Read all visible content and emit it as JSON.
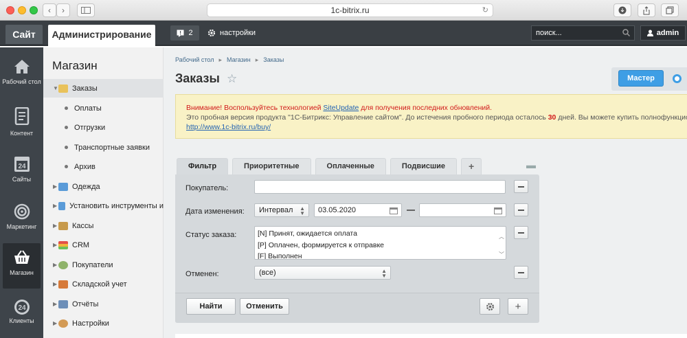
{
  "browser": {
    "url": "1c-bitrix.ru"
  },
  "topbar": {
    "site_tab": "Сайт",
    "admin_tab": "Администрирование",
    "notif_count": "2",
    "settings_label": "настройки",
    "search_placeholder": "поиск...",
    "user_name": "admin"
  },
  "leftnav": {
    "items": [
      {
        "label": "Рабочий стол",
        "icon": "home-icon"
      },
      {
        "label": "Контент",
        "icon": "document-icon"
      },
      {
        "label": "Сайты",
        "icon": "calendar-24-icon"
      },
      {
        "label": "Маркетинг",
        "icon": "target-icon"
      },
      {
        "label": "Магазин",
        "icon": "basket-icon",
        "active": true
      },
      {
        "label": "Клиенты",
        "icon": "clients-24-icon"
      }
    ]
  },
  "sidemenu": {
    "title": "Магазин",
    "items": [
      {
        "label": "Заказы",
        "type": "folder",
        "selected": true
      },
      {
        "label": "Оплаты",
        "type": "sub"
      },
      {
        "label": "Отгрузки",
        "type": "sub"
      },
      {
        "label": "Транспортные заявки",
        "type": "sub"
      },
      {
        "label": "Архив",
        "type": "sub"
      },
      {
        "label": "Одежда",
        "type": "folder"
      },
      {
        "label": "Установить инструменты и",
        "type": "folder"
      },
      {
        "label": "Кассы",
        "type": "folder"
      },
      {
        "label": "CRM",
        "type": "folder"
      },
      {
        "label": "Покупатели",
        "type": "folder"
      },
      {
        "label": "Складской учет",
        "type": "folder"
      },
      {
        "label": "Отчёты",
        "type": "folder"
      },
      {
        "label": "Настройки",
        "type": "folder"
      }
    ]
  },
  "breadcrumb": [
    "Рабочий стол",
    "Магазин",
    "Заказы"
  ],
  "page": {
    "title": "Заказы",
    "master_button": "Мастер"
  },
  "warning": {
    "line1_prefix": "Внимание! Воспользуйтесь технологией ",
    "line1_link": "SiteUpdate",
    "line1_suffix": " для получения последних обновлений.",
    "line2_prefix": "Это пробная версия продукта \"1С-Битрикс: Управление сайтом\". До истечения пробного периода осталось ",
    "line2_days": "30",
    "line2_suffix": " дней. Вы можете купить полнофункциональ",
    "line3_link": "http://www.1c-bitrix.ru/buy/"
  },
  "filter": {
    "tabs": [
      "Фильтр",
      "Приоритетные",
      "Оплаченные",
      "Подвисшие"
    ],
    "buyer_label": "Покупатель:",
    "buyer_value": "",
    "date_label": "Дата изменения:",
    "date_mode": "Интервал",
    "date_from": "03.05.2020",
    "date_to": "",
    "status_label": "Статус заказа:",
    "status_options": [
      "[N] Принят, ожидается оплата",
      "[P] Оплачен, формируется к отправке",
      "[F] Выполнен"
    ],
    "cancelled_label": "Отменен:",
    "cancelled_value": "(все)",
    "find_button": "Найти",
    "cancel_button": "Отменить"
  },
  "colors": {
    "topbar": "#3a3f44",
    "leftnav": "#3e444a",
    "accent": "#3e9ee5",
    "warning_bg": "#f9f2c6",
    "warning_text": "#d11a1a"
  }
}
